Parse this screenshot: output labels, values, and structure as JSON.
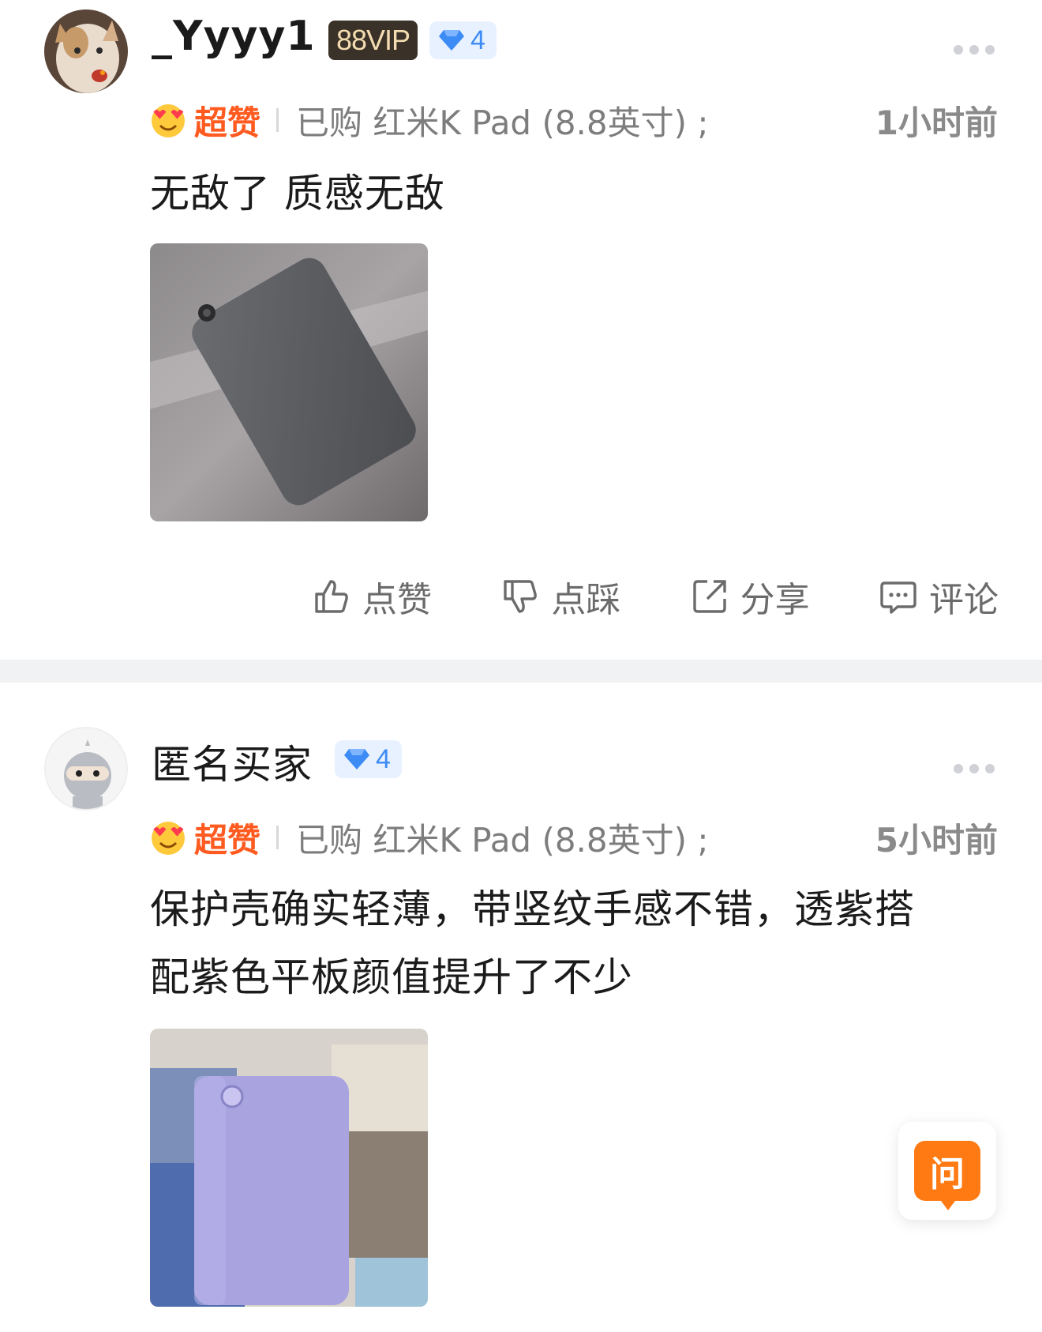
{
  "reviews": [
    {
      "username": "_Yyyy1",
      "vip_badge": "88VIP",
      "level": "4",
      "rating_label": "超赞",
      "purchase": "已购 红米K Pad (8.8英寸) ;",
      "time": "1小时前",
      "text": "无敌了  质感无敌",
      "photo_icon": "gray-tablet-photo",
      "actions": {
        "like": "点赞",
        "dislike": "点踩",
        "share": "分享",
        "comment": "评论"
      }
    },
    {
      "username": "匿名买家",
      "level": "4",
      "rating_label": "超赞",
      "purchase": "已购 红米K Pad (8.8英寸) ;",
      "time": "5小时前",
      "text": "保护壳确实轻薄，带竖纹手感不错，透紫搭配紫色平板颜值提升了不少",
      "photo_icon": "purple-tablet-photo"
    }
  ],
  "ask_button": "问",
  "colors": {
    "accent_orange": "#ff5a1f",
    "level_blue": "#3d8bf5",
    "ask_orange": "#ff7a12"
  }
}
